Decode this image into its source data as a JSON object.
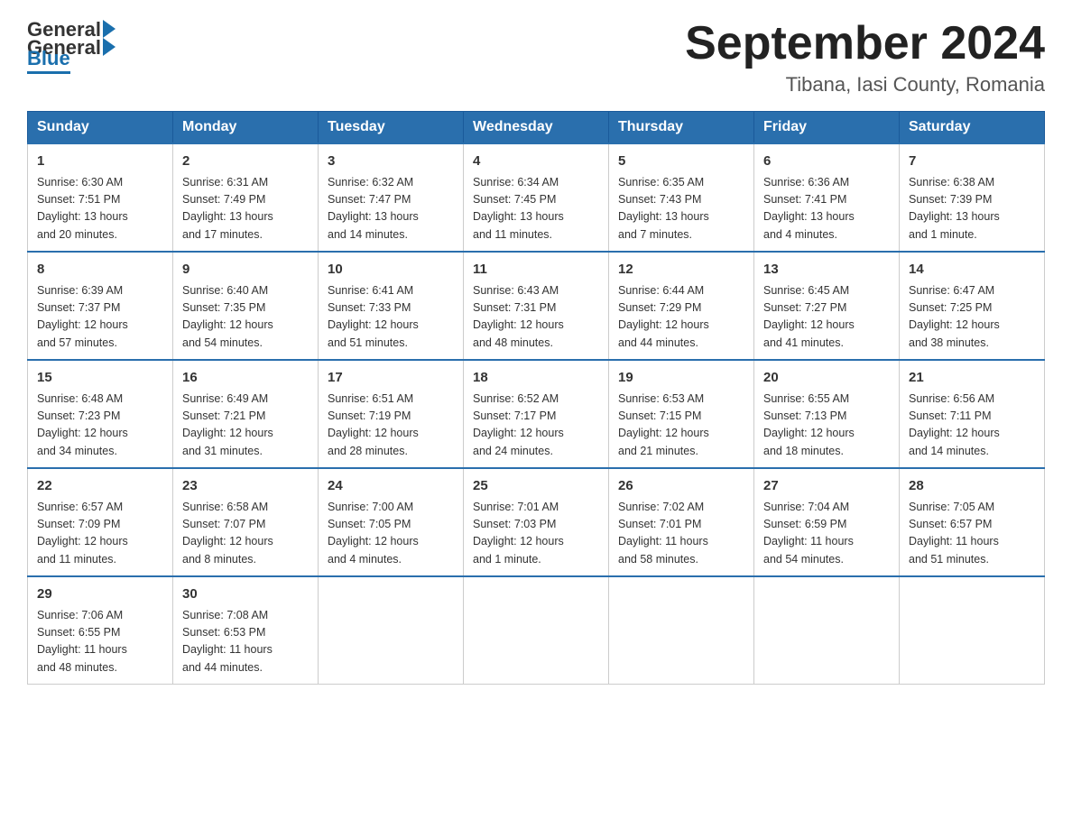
{
  "logo": {
    "general": "General",
    "blue": "Blue"
  },
  "title": "September 2024",
  "subtitle": "Tibana, Iasi County, Romania",
  "days_of_week": [
    "Sunday",
    "Monday",
    "Tuesday",
    "Wednesday",
    "Thursday",
    "Friday",
    "Saturday"
  ],
  "weeks": [
    [
      {
        "day": "1",
        "info": "Sunrise: 6:30 AM\nSunset: 7:51 PM\nDaylight: 13 hours\nand 20 minutes."
      },
      {
        "day": "2",
        "info": "Sunrise: 6:31 AM\nSunset: 7:49 PM\nDaylight: 13 hours\nand 17 minutes."
      },
      {
        "day": "3",
        "info": "Sunrise: 6:32 AM\nSunset: 7:47 PM\nDaylight: 13 hours\nand 14 minutes."
      },
      {
        "day": "4",
        "info": "Sunrise: 6:34 AM\nSunset: 7:45 PM\nDaylight: 13 hours\nand 11 minutes."
      },
      {
        "day": "5",
        "info": "Sunrise: 6:35 AM\nSunset: 7:43 PM\nDaylight: 13 hours\nand 7 minutes."
      },
      {
        "day": "6",
        "info": "Sunrise: 6:36 AM\nSunset: 7:41 PM\nDaylight: 13 hours\nand 4 minutes."
      },
      {
        "day": "7",
        "info": "Sunrise: 6:38 AM\nSunset: 7:39 PM\nDaylight: 13 hours\nand 1 minute."
      }
    ],
    [
      {
        "day": "8",
        "info": "Sunrise: 6:39 AM\nSunset: 7:37 PM\nDaylight: 12 hours\nand 57 minutes."
      },
      {
        "day": "9",
        "info": "Sunrise: 6:40 AM\nSunset: 7:35 PM\nDaylight: 12 hours\nand 54 minutes."
      },
      {
        "day": "10",
        "info": "Sunrise: 6:41 AM\nSunset: 7:33 PM\nDaylight: 12 hours\nand 51 minutes."
      },
      {
        "day": "11",
        "info": "Sunrise: 6:43 AM\nSunset: 7:31 PM\nDaylight: 12 hours\nand 48 minutes."
      },
      {
        "day": "12",
        "info": "Sunrise: 6:44 AM\nSunset: 7:29 PM\nDaylight: 12 hours\nand 44 minutes."
      },
      {
        "day": "13",
        "info": "Sunrise: 6:45 AM\nSunset: 7:27 PM\nDaylight: 12 hours\nand 41 minutes."
      },
      {
        "day": "14",
        "info": "Sunrise: 6:47 AM\nSunset: 7:25 PM\nDaylight: 12 hours\nand 38 minutes."
      }
    ],
    [
      {
        "day": "15",
        "info": "Sunrise: 6:48 AM\nSunset: 7:23 PM\nDaylight: 12 hours\nand 34 minutes."
      },
      {
        "day": "16",
        "info": "Sunrise: 6:49 AM\nSunset: 7:21 PM\nDaylight: 12 hours\nand 31 minutes."
      },
      {
        "day": "17",
        "info": "Sunrise: 6:51 AM\nSunset: 7:19 PM\nDaylight: 12 hours\nand 28 minutes."
      },
      {
        "day": "18",
        "info": "Sunrise: 6:52 AM\nSunset: 7:17 PM\nDaylight: 12 hours\nand 24 minutes."
      },
      {
        "day": "19",
        "info": "Sunrise: 6:53 AM\nSunset: 7:15 PM\nDaylight: 12 hours\nand 21 minutes."
      },
      {
        "day": "20",
        "info": "Sunrise: 6:55 AM\nSunset: 7:13 PM\nDaylight: 12 hours\nand 18 minutes."
      },
      {
        "day": "21",
        "info": "Sunrise: 6:56 AM\nSunset: 7:11 PM\nDaylight: 12 hours\nand 14 minutes."
      }
    ],
    [
      {
        "day": "22",
        "info": "Sunrise: 6:57 AM\nSunset: 7:09 PM\nDaylight: 12 hours\nand 11 minutes."
      },
      {
        "day": "23",
        "info": "Sunrise: 6:58 AM\nSunset: 7:07 PM\nDaylight: 12 hours\nand 8 minutes."
      },
      {
        "day": "24",
        "info": "Sunrise: 7:00 AM\nSunset: 7:05 PM\nDaylight: 12 hours\nand 4 minutes."
      },
      {
        "day": "25",
        "info": "Sunrise: 7:01 AM\nSunset: 7:03 PM\nDaylight: 12 hours\nand 1 minute."
      },
      {
        "day": "26",
        "info": "Sunrise: 7:02 AM\nSunset: 7:01 PM\nDaylight: 11 hours\nand 58 minutes."
      },
      {
        "day": "27",
        "info": "Sunrise: 7:04 AM\nSunset: 6:59 PM\nDaylight: 11 hours\nand 54 minutes."
      },
      {
        "day": "28",
        "info": "Sunrise: 7:05 AM\nSunset: 6:57 PM\nDaylight: 11 hours\nand 51 minutes."
      }
    ],
    [
      {
        "day": "29",
        "info": "Sunrise: 7:06 AM\nSunset: 6:55 PM\nDaylight: 11 hours\nand 48 minutes."
      },
      {
        "day": "30",
        "info": "Sunrise: 7:08 AM\nSunset: 6:53 PM\nDaylight: 11 hours\nand 44 minutes."
      },
      {
        "day": "",
        "info": ""
      },
      {
        "day": "",
        "info": ""
      },
      {
        "day": "",
        "info": ""
      },
      {
        "day": "",
        "info": ""
      },
      {
        "day": "",
        "info": ""
      }
    ]
  ]
}
